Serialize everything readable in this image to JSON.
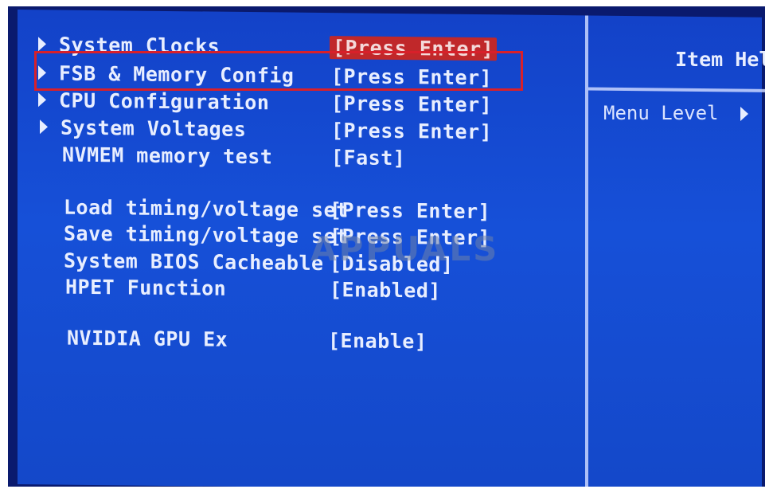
{
  "menu": [
    {
      "label": "System Clocks",
      "value": "[Press Enter]",
      "submenu": true,
      "selected": true
    },
    {
      "label": "FSB & Memory Config",
      "value": "[Press Enter]",
      "submenu": true,
      "selected": false
    },
    {
      "label": "CPU Configuration",
      "value": "[Press Enter]",
      "submenu": true,
      "selected": false
    },
    {
      "label": "System Voltages",
      "value": "[Press Enter]",
      "submenu": true,
      "selected": false
    },
    {
      "label": "NVMEM memory test",
      "value": "[Fast]",
      "submenu": false,
      "selected": false
    },
    {
      "label": "Load timing/voltage set",
      "value": "[Press Enter]",
      "submenu": false,
      "selected": false
    },
    {
      "label": "Save timing/voltage set",
      "value": "[Press Enter]",
      "submenu": false,
      "selected": false
    },
    {
      "label": "System BIOS Cacheable",
      "value": "[Disabled]",
      "submenu": false,
      "selected": false
    },
    {
      "label": "HPET Function",
      "value": "[Enabled]",
      "submenu": false,
      "selected": false
    },
    {
      "label": "NVIDIA GPU Ex",
      "value": "[Enable]",
      "submenu": false,
      "selected": false
    }
  ],
  "help_panel": {
    "title": "Item Help",
    "menu_level_label": "Menu Level"
  },
  "watermark": "APPUALS",
  "colors": {
    "bios_background": "#1650d8",
    "text": "#e8eeff",
    "selection": "#c0282a",
    "highlight_box": "#d8202a"
  }
}
